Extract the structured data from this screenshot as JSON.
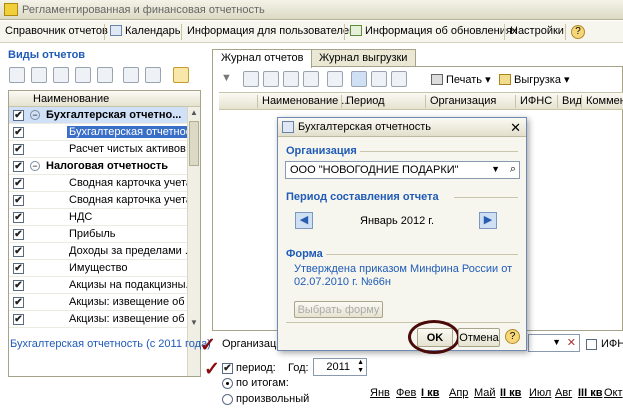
{
  "window": {
    "title": "Регламентированная и финансовая отчетность"
  },
  "menu": {
    "items": [
      "Справочник отчетов",
      "Календарь",
      "Информация для пользователей",
      "Информация об обновлениях",
      "Настройки"
    ]
  },
  "left": {
    "header": "Виды отчетов",
    "column": "Наименование",
    "rows": [
      {
        "label": "Бухгалтерская отчетно...",
        "group": true
      },
      {
        "label": "Бухгалтерская отчетнос...",
        "group": false
      },
      {
        "label": "Расчет чистых активов",
        "group": false
      },
      {
        "label": "Налоговая отчетность",
        "group": true
      },
      {
        "label": "Сводная карточка учета...",
        "group": false
      },
      {
        "label": "Сводная карточка учета...",
        "group": false
      },
      {
        "label": "НДС",
        "group": false
      },
      {
        "label": "Прибыль",
        "group": false
      },
      {
        "label": "Доходы за пределами ...",
        "group": false
      },
      {
        "label": "Имущество",
        "group": false
      },
      {
        "label": "Акцизы на подакцизны...",
        "group": false
      },
      {
        "label": "Акцизы: извещение об ...",
        "group": false
      },
      {
        "label": "Акцизы: извещение об ...",
        "group": false
      }
    ],
    "link": "Бухгалтерская отчетность (с 2011 года)"
  },
  "right": {
    "tabs": [
      "Журнал отчетов",
      "Журнал выгрузки"
    ],
    "toolbar": {
      "print": "Печать",
      "export": "Выгрузка"
    },
    "columns": [
      "Наименование ...",
      "Период",
      "Организация",
      "ИФНС",
      "Вид",
      "Коммен"
    ]
  },
  "bottom": {
    "org_label": "Организаци",
    "period_label": "период:",
    "year_label": "Год:",
    "year": "2011",
    "radio1": "по итогам:",
    "radio2": "произвольный",
    "ifns_label": "ИФН",
    "months": [
      "Янв",
      "Фев",
      "I кв",
      "Апр",
      "Май",
      "II кв",
      "Июл",
      "Авг",
      "III кв",
      "Окт"
    ]
  },
  "dialog": {
    "title": "Бухгалтерская отчетность",
    "org_section": "Организация",
    "org_value": "ООО \"НОВОГОДНИЕ ПОДАРКИ\"",
    "period_section": "Период составления отчета",
    "period_value": "Январь 2012 г.",
    "form_section": "Форма",
    "form_link": "Утверждена приказом Минфина России от 02.07.2010 г. №66н",
    "choose_form": "Выбрать форму",
    "ok": "OK",
    "cancel": "Отмена"
  }
}
